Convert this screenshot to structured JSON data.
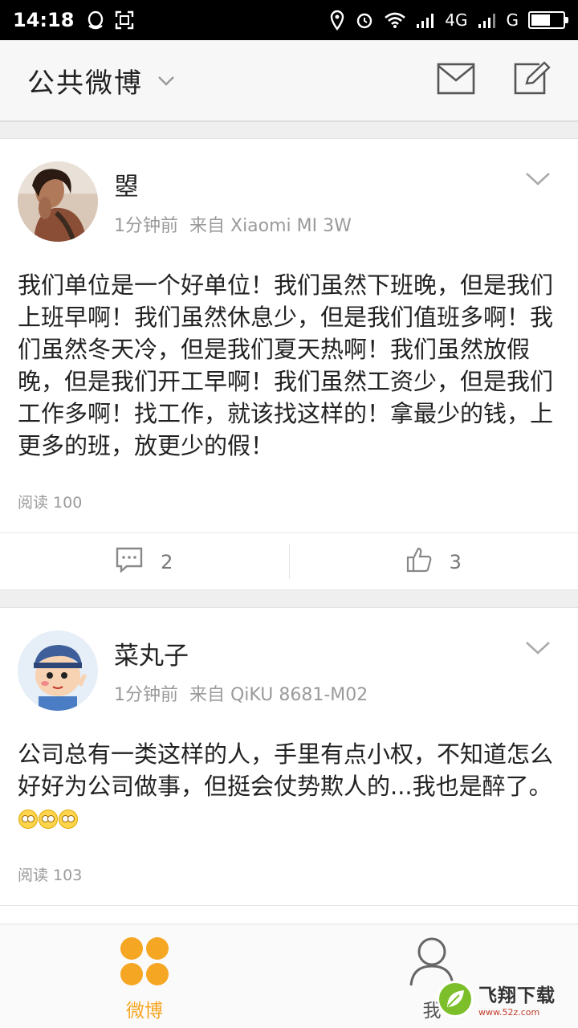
{
  "status_bar": {
    "time": "14:18",
    "network_4g": "4G",
    "network_g": "G",
    "battery_level": 0.6
  },
  "header": {
    "title": "公共微博"
  },
  "posts": [
    {
      "username": "曌",
      "time_ago": "1分钟前",
      "source": "来自 Xiaomi MI 3W",
      "content": "我们单位是一个好单位！我们虽然下班晚，但是我们上班早啊！我们虽然休息少，但是我们值班多啊！我们虽然冬天冷，但是我们夏天热啊！我们虽然放假晚，但是我们开工早啊！我们虽然工资少，但是我们工作多啊！找工作，就该找这样的！拿最少的钱，上更多的班，放更少的假！",
      "reads_label": "阅读",
      "reads_count": "100",
      "comments": "2",
      "likes": "3"
    },
    {
      "username": "菜丸子",
      "time_ago": "1分钟前",
      "source": "来自 QiKU 8681-M02",
      "content": "公司总有一类这样的人，手里有点小权，不知道怎么好好为公司做事，但挺会仗势欺人的...我也是醉了。",
      "reads_label": "阅读",
      "reads_count": "103"
    }
  ],
  "bottom_nav": {
    "weibo_label": "微博",
    "me_label": "我"
  },
  "watermark": {
    "main": "飞翔下载",
    "sub": "www.52z.com"
  },
  "colors": {
    "accent": "#f5a623",
    "status_bar_bg": "#000000",
    "header_bg": "#f7f7f7",
    "feed_bg": "#efefef"
  }
}
